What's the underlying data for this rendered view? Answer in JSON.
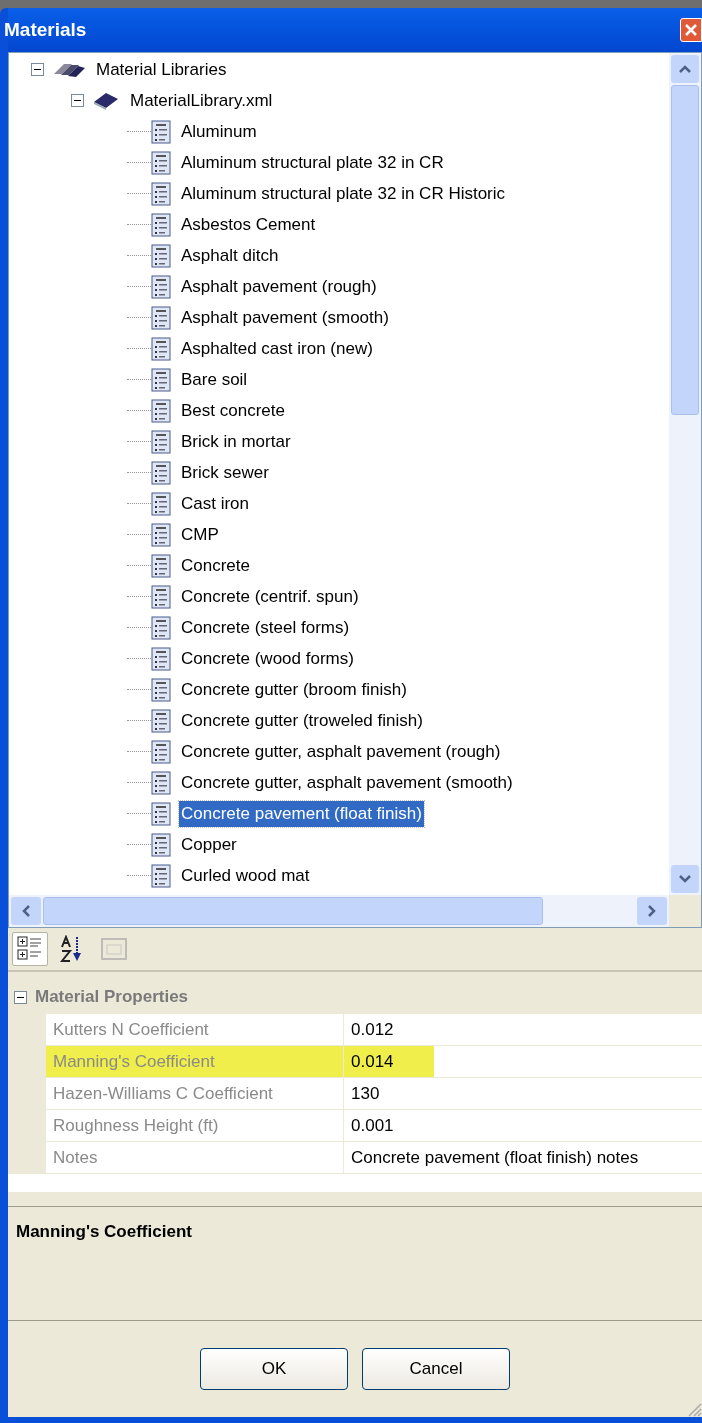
{
  "window": {
    "title": "Materials"
  },
  "tree": [
    {
      "label": "Material Libraries",
      "kind": "libraries",
      "expanded": true,
      "children": [
        {
          "label": "MaterialLibrary.xml",
          "kind": "library",
          "expanded": true,
          "children": [
            {
              "label": "Aluminum",
              "selected": false
            },
            {
              "label": "Aluminum structural plate 32 in CR",
              "selected": false
            },
            {
              "label": "Aluminum structural plate 32 in CR Historic",
              "selected": false
            },
            {
              "label": "Asbestos Cement",
              "selected": false
            },
            {
              "label": "Asphalt ditch",
              "selected": false
            },
            {
              "label": "Asphalt pavement (rough)",
              "selected": false
            },
            {
              "label": "Asphalt pavement (smooth)",
              "selected": false
            },
            {
              "label": "Asphalted cast iron (new)",
              "selected": false
            },
            {
              "label": "Bare soil",
              "selected": false
            },
            {
              "label": "Best concrete",
              "selected": false
            },
            {
              "label": "Brick in mortar",
              "selected": false
            },
            {
              "label": "Brick sewer",
              "selected": false
            },
            {
              "label": "Cast iron",
              "selected": false
            },
            {
              "label": "CMP",
              "selected": false
            },
            {
              "label": "Concrete",
              "selected": false
            },
            {
              "label": "Concrete (centrif. spun)",
              "selected": false
            },
            {
              "label": "Concrete (steel forms)",
              "selected": false
            },
            {
              "label": "Concrete (wood forms)",
              "selected": false
            },
            {
              "label": "Concrete gutter (broom finish)",
              "selected": false
            },
            {
              "label": "Concrete gutter (troweled finish)",
              "selected": false
            },
            {
              "label": "Concrete gutter, asphalt pavement (rough)",
              "selected": false
            },
            {
              "label": "Concrete gutter, asphalt pavement (smooth)",
              "selected": false
            },
            {
              "label": "Concrete pavement (float finish)",
              "selected": true
            },
            {
              "label": "Copper",
              "selected": false
            },
            {
              "label": "Curled wood mat",
              "selected": false
            }
          ]
        }
      ]
    }
  ],
  "toolbar": [
    {
      "kind": "categorized",
      "selected": true
    },
    {
      "kind": "alphabetical",
      "selected": false
    },
    {
      "kind": "pages",
      "selected": false,
      "disabled": true
    }
  ],
  "properties": {
    "category": "Material Properties",
    "expanded": true,
    "rows": [
      {
        "name": "Kutters N Coefficient",
        "value": "0.012",
        "highlighted": false
      },
      {
        "name": "Manning's Coefficient",
        "value": "0.014",
        "highlighted": true
      },
      {
        "name": "Hazen-Williams C Coefficient",
        "value": "130",
        "highlighted": false
      },
      {
        "name": "Roughness Height (ft)",
        "value": "0.001",
        "highlighted": false
      },
      {
        "name": "Notes",
        "value": "Concrete pavement (float finish) notes",
        "highlighted": false
      }
    ]
  },
  "description": {
    "title": "Manning's Coefficient"
  },
  "buttons": [
    "OK",
    "Cancel"
  ]
}
